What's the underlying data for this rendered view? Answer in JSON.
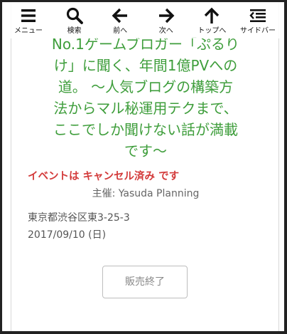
{
  "toolbar": {
    "items": [
      {
        "label": "メニュー",
        "icon": "menu-icon"
      },
      {
        "label": "検索",
        "icon": "search-icon"
      },
      {
        "label": "前へ",
        "icon": "arrow-left-icon"
      },
      {
        "label": "次へ",
        "icon": "arrow-right-icon"
      },
      {
        "label": "トップへ",
        "icon": "arrow-up-icon"
      },
      {
        "label": "サイドバー",
        "icon": "sidebar-icon"
      }
    ]
  },
  "event": {
    "title": "No.1ゲームブロガー「ぷるり\nけ」に聞く、年間1億PVへの\n道。 〜人気ブログの構築方\n法からマル秘運用テクまで、\nここでしか聞けない話が満載\nです〜",
    "status": "イベントは キャンセル済み です",
    "organizer": "主催: Yasuda Planning",
    "address": "東京都渋谷区東3-25-3",
    "date": "2017/09/10 (日)",
    "button_label": "販売終了"
  },
  "colors": {
    "title": "#3f9e3c",
    "status": "#d33a3a"
  }
}
